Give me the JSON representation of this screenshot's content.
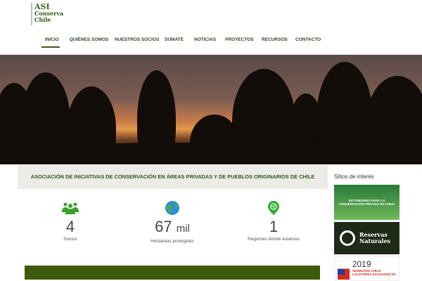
{
  "logo": {
    "line1": "ASI",
    "line2": "Conserva",
    "line3": "Chile"
  },
  "nav": [
    "INICIO",
    "QUIÉNES SOMOS",
    "NUESTROS SOCIOS",
    "SÚMATE",
    "NOTICIAS",
    "PROYECTOS",
    "RECURSOS",
    "CONTACTO"
  ],
  "banner": "ASOCIACIÓN DE INICIATIVAS DE CONSERVACIÓN EN ÁREAS PRIVADAS Y DE PUEBLOS ORIGINARIOS DE CHILE",
  "stats": [
    {
      "icon": "users-icon",
      "number": "4",
      "unit": "",
      "label": "Socios"
    },
    {
      "icon": "globe-icon",
      "number": "67",
      "unit": "mil",
      "label": "Hectáreas protegidas"
    },
    {
      "icon": "map-pin-icon",
      "number": "1",
      "unit": "",
      "label": "Regiones donde estamos"
    }
  ],
  "sidebar": {
    "title": "Sitios de interés",
    "cards": [
      {
        "text": "ESTÁNDARES PARA LA CONSERVACIÓN PRIVADA EN CHILE"
      },
      {
        "title1": "Reservas",
        "title2": "Naturales"
      },
      {
        "year": "2019",
        "text": "SEMINARIO CHILE-CALIFORNIA EXCHANGE EN"
      }
    ]
  },
  "colors": {
    "brand": "#3e5a0c",
    "accent": "#3aa02c"
  }
}
